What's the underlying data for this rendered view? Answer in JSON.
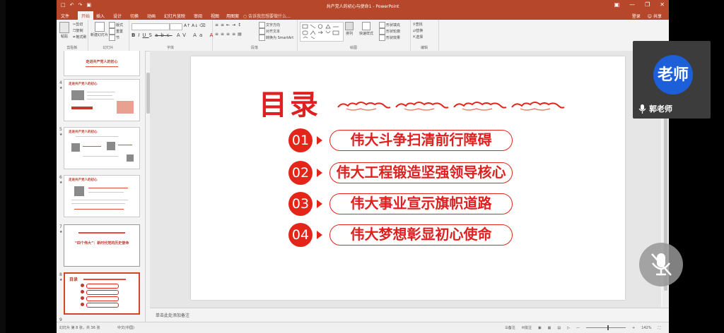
{
  "app": {
    "window_title": "共产党人的初心与使命1 - PowerPoint",
    "qat_icons": [
      "save-icon",
      "undo-icon",
      "redo-icon",
      "start-slideshow-icon"
    ],
    "window_controls": [
      "ribbon-display-icon",
      "minimize-icon",
      "restore-icon",
      "close-icon"
    ]
  },
  "tabs": [
    "文件",
    "开始",
    "插入",
    "设计",
    "切换",
    "动画",
    "幻灯片放映",
    "审阅",
    "视图",
    "用图案"
  ],
  "active_tab": "开始",
  "tellme_placeholder": "告诉我您想要做什么...",
  "account": {
    "signin": "登录",
    "share": "共享"
  },
  "ribbon": {
    "clipboard": {
      "label": "剪贴板",
      "paste": "粘贴",
      "cut": "剪切",
      "copy": "复制",
      "format_painter": "格式刷"
    },
    "slides": {
      "label": "幻灯片",
      "new_slide": "新建幻灯片",
      "layout": "版式",
      "reset": "重置",
      "section": "节"
    },
    "font": {
      "label": "字体"
    },
    "paragraph": {
      "label": "段落",
      "text_direction": "文字方向",
      "align_text": "对齐文本",
      "smartart": "转换为 SmartArt"
    },
    "drawing": {
      "label": "绘图",
      "arrange": "排列",
      "quick_styles": "快速样式",
      "shape_fill": "形状填充",
      "shape_outline": "形状轮廓",
      "shape_effects": "形状效果"
    },
    "editing": {
      "label": "编辑",
      "find": "查找",
      "replace": "替换",
      "select": "选择"
    }
  },
  "thumbnails": [
    {
      "number": "",
      "title": "走进共产党人的初心"
    },
    {
      "number": "4",
      "title": "走进共产党人的初心"
    },
    {
      "number": "5",
      "title": "走进共产党人的初心"
    },
    {
      "number": "6",
      "title": "走进共产党人的初心"
    },
    {
      "number": "7",
      "title": "“四个伟大”：新时代党的历史使命"
    },
    {
      "number": "8",
      "title": "目录"
    },
    {
      "number": "9",
      "title": ""
    }
  ],
  "slide": {
    "title": "目录",
    "items": [
      {
        "num": "01",
        "text": "伟大斗争扫清前行障碍"
      },
      {
        "num": "02",
        "text": "伟大工程锻造坚强领导核心"
      },
      {
        "num": "03",
        "text": "伟大事业宣示旗帜道路"
      },
      {
        "num": "04",
        "text": "伟大梦想彰显初心使命"
      }
    ],
    "colors": {
      "accent": "#e42519",
      "title": "#e02020"
    }
  },
  "notes_placeholder": "单击此处添加备注",
  "status": {
    "slide_info": "幻灯片 第 8 张，共 36 张",
    "language": "中文(中国)",
    "notes": "备注",
    "comments": "批注",
    "zoom": "142%"
  },
  "video": {
    "avatar_text": "老师",
    "name": "郭老师",
    "mic_icon": "microphone-icon",
    "mic_muted_icon": "microphone-muted-icon"
  }
}
